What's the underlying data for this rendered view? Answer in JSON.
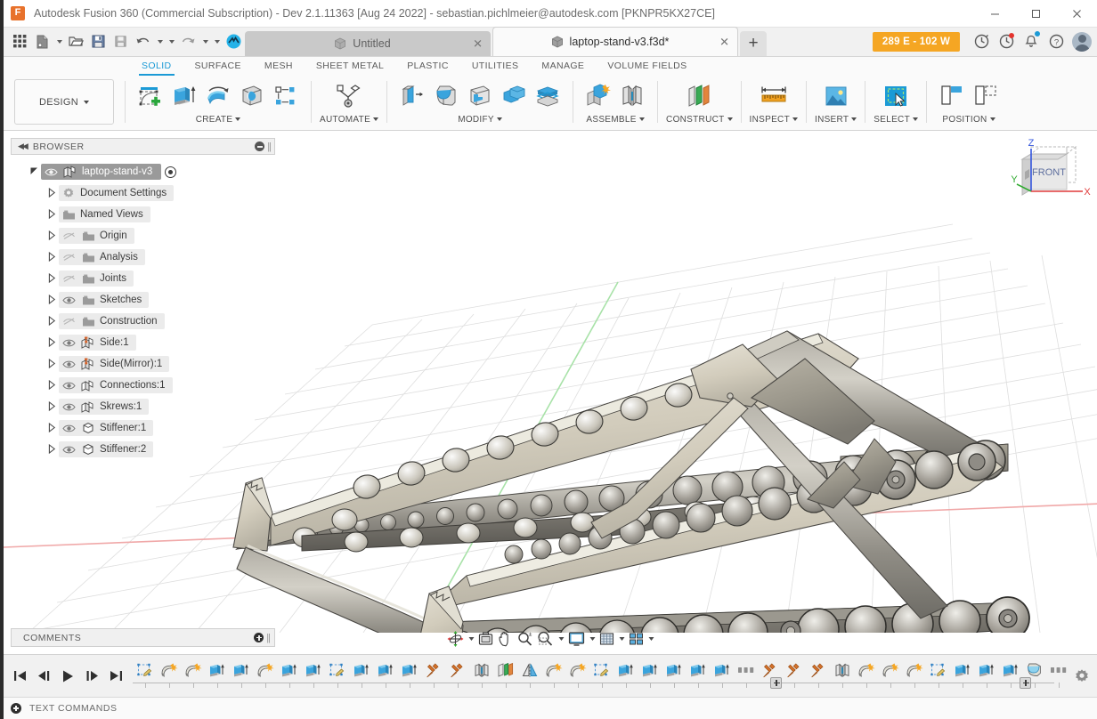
{
  "titlebar": {
    "app_title": "Autodesk Fusion 360 (Commercial Subscription) - Dev 2.1.11363 [Aug 24 2022] - sebastian.pichlmeier@autodesk.com [PKNPR5KX27CE]",
    "logo": "fusion-logo",
    "minimize": "minimize",
    "maximize": "maximize",
    "close": "close"
  },
  "quick_access": {
    "buttons": [
      "app-grid",
      "new-file",
      "open",
      "save",
      "save-as",
      "undo",
      "redo",
      "data-panel"
    ]
  },
  "tabs": [
    {
      "label": "Untitled",
      "active": false
    },
    {
      "label": "laptop-stand-v3.f3d*",
      "active": true
    }
  ],
  "tab_add_label": "+",
  "header_right": {
    "power_badge": "289 E - 102 W",
    "icons": [
      "job-status-icon",
      "notifications-activity-icon",
      "bell-icon",
      "help-icon",
      "avatar"
    ]
  },
  "ribbon_tabs": [
    {
      "label": "SOLID",
      "selected": true
    },
    {
      "label": "SURFACE",
      "selected": false
    },
    {
      "label": "MESH",
      "selected": false
    },
    {
      "label": "SHEET METAL",
      "selected": false
    },
    {
      "label": "PLASTIC",
      "selected": false
    },
    {
      "label": "UTILITIES",
      "selected": false
    },
    {
      "label": "MANAGE",
      "selected": false
    },
    {
      "label": "VOLUME FIELDS",
      "selected": false
    }
  ],
  "workspace_selector": {
    "label": "DESIGN"
  },
  "ribbon_groups": [
    {
      "label": "CREATE",
      "icons": [
        "create-sketch-icon",
        "extrude-icon",
        "revolve-icon",
        "sweep-icon",
        "pattern-icon"
      ]
    },
    {
      "label": "AUTOMATE",
      "icons": [
        "automate-icon"
      ]
    },
    {
      "label": "MODIFY",
      "icons": [
        "press-pull-icon",
        "fillet-icon",
        "shell-icon",
        "combine-icon",
        "offset-face-icon"
      ]
    },
    {
      "label": "ASSEMBLE",
      "icons": [
        "new-component-icon",
        "joint-icon"
      ]
    },
    {
      "label": "CONSTRUCT",
      "icons": [
        "offset-plane-icon"
      ]
    },
    {
      "label": "INSPECT",
      "icons": [
        "measure-icon"
      ]
    },
    {
      "label": "INSERT",
      "icons": [
        "insert-image-icon"
      ]
    },
    {
      "label": "SELECT",
      "icons": [
        "select-window-icon"
      ]
    },
    {
      "label": "POSITION",
      "icons": [
        "align-icon",
        "move-copy-icon"
      ]
    }
  ],
  "browser": {
    "title": "BROWSER",
    "collapse_icon": "collapse-panel-icon",
    "tree": [
      {
        "label": "laptop-stand-v3",
        "icon": "component-icon",
        "expanded": true,
        "selected": true,
        "visible": true,
        "has_radio": true,
        "indent": 0
      },
      {
        "label": "Document Settings",
        "icon": "gear-icon",
        "expanded": false,
        "eye": "none",
        "indent": 1
      },
      {
        "label": "Named Views",
        "icon": "folder-icon",
        "expanded": false,
        "eye": "none",
        "indent": 1
      },
      {
        "label": "Origin",
        "icon": "folder-icon",
        "expanded": false,
        "eye": "hidden",
        "indent": 1
      },
      {
        "label": "Analysis",
        "icon": "folder-icon",
        "expanded": false,
        "eye": "hidden",
        "indent": 1
      },
      {
        "label": "Joints",
        "icon": "folder-icon",
        "expanded": false,
        "eye": "hidden",
        "indent": 1
      },
      {
        "label": "Sketches",
        "icon": "folder-icon",
        "expanded": false,
        "eye": "visible",
        "indent": 1
      },
      {
        "label": "Construction",
        "icon": "folder-icon",
        "expanded": false,
        "eye": "hidden",
        "indent": 1
      },
      {
        "label": "Side:1",
        "icon": "component-pinned-icon",
        "expanded": false,
        "eye": "visible",
        "indent": 1
      },
      {
        "label": "Side(Mirror):1",
        "icon": "component-pinned-icon",
        "expanded": false,
        "eye": "visible",
        "indent": 1
      },
      {
        "label": "Connections:1",
        "icon": "component-icon",
        "expanded": false,
        "eye": "visible",
        "indent": 1
      },
      {
        "label": "Skrews:1",
        "icon": "component-icon",
        "expanded": false,
        "eye": "visible",
        "indent": 1
      },
      {
        "label": "Stiffener:1",
        "icon": "body-icon",
        "expanded": false,
        "eye": "visible",
        "indent": 1
      },
      {
        "label": "Stiffener:2",
        "icon": "body-icon",
        "expanded": false,
        "eye": "visible",
        "indent": 1
      }
    ]
  },
  "comments": {
    "title": "COMMENTS",
    "add_icon": "add-comment-icon"
  },
  "viewcube": {
    "face_label": "FRONT",
    "axes": [
      {
        "name": "Z",
        "color": "#3355dd"
      },
      {
        "name": "X",
        "color": "#e03a3a"
      },
      {
        "name": "Y",
        "color": "#2faa2f"
      }
    ]
  },
  "navbar": {
    "buttons": [
      "orbit-icon",
      "look-at-icon",
      "pan-icon",
      "zoom-icon",
      "zoom-window-icon",
      "display-settings-icon",
      "grid-snaps-icon",
      "viewports-icon"
    ]
  },
  "timeline": {
    "playback": [
      "go-to-beginning",
      "step-back",
      "play-forward",
      "step-forward",
      "go-to-end"
    ],
    "features": [
      "sketch-icon",
      "revolve-icon",
      "revolve-icon",
      "extrude-icon",
      "extrude-icon",
      "revolve-icon",
      "extrude-icon",
      "extrude-icon",
      "sketch-icon",
      "extrude-icon",
      "extrude-icon",
      "extrude-icon",
      "pin-icon",
      "pin-icon",
      "joint-icon",
      "construct-plane-icon",
      "mirror-icon",
      "revolve-icon",
      "revolve-icon",
      "sketch-icon",
      "extrude-icon",
      "extrude-icon",
      "extrude-icon",
      "extrude-icon",
      "extrude-icon",
      "pattern-icon",
      "pin-icon",
      "pin-icon",
      "pin-icon",
      "joint-icon",
      "revolve-icon",
      "revolve-icon",
      "revolve-icon",
      "sketch-icon",
      "extrude-icon",
      "extrude-icon",
      "extrude-icon",
      "fillet-icon",
      "pattern-icon",
      "revolve-icon",
      "sketch-icon",
      "extrude-icon",
      "extrude-icon",
      "extrude-icon",
      "pattern-icon"
    ],
    "settings_icon": "timeline-settings-icon"
  },
  "statusbar": {
    "label": "TEXT COMMANDS",
    "toggle_icon": "expand-icon"
  },
  "colors": {
    "accent": "#1b9ad6",
    "badge": "#f5a623",
    "brand": "#e8722c",
    "model_light": "#d7d2c4",
    "model_mid": "#9a968c",
    "model_dark": "#6f6d66",
    "axis_x": "#e03a3a",
    "axis_y": "#2faa2f",
    "axis_z": "#3355dd"
  }
}
